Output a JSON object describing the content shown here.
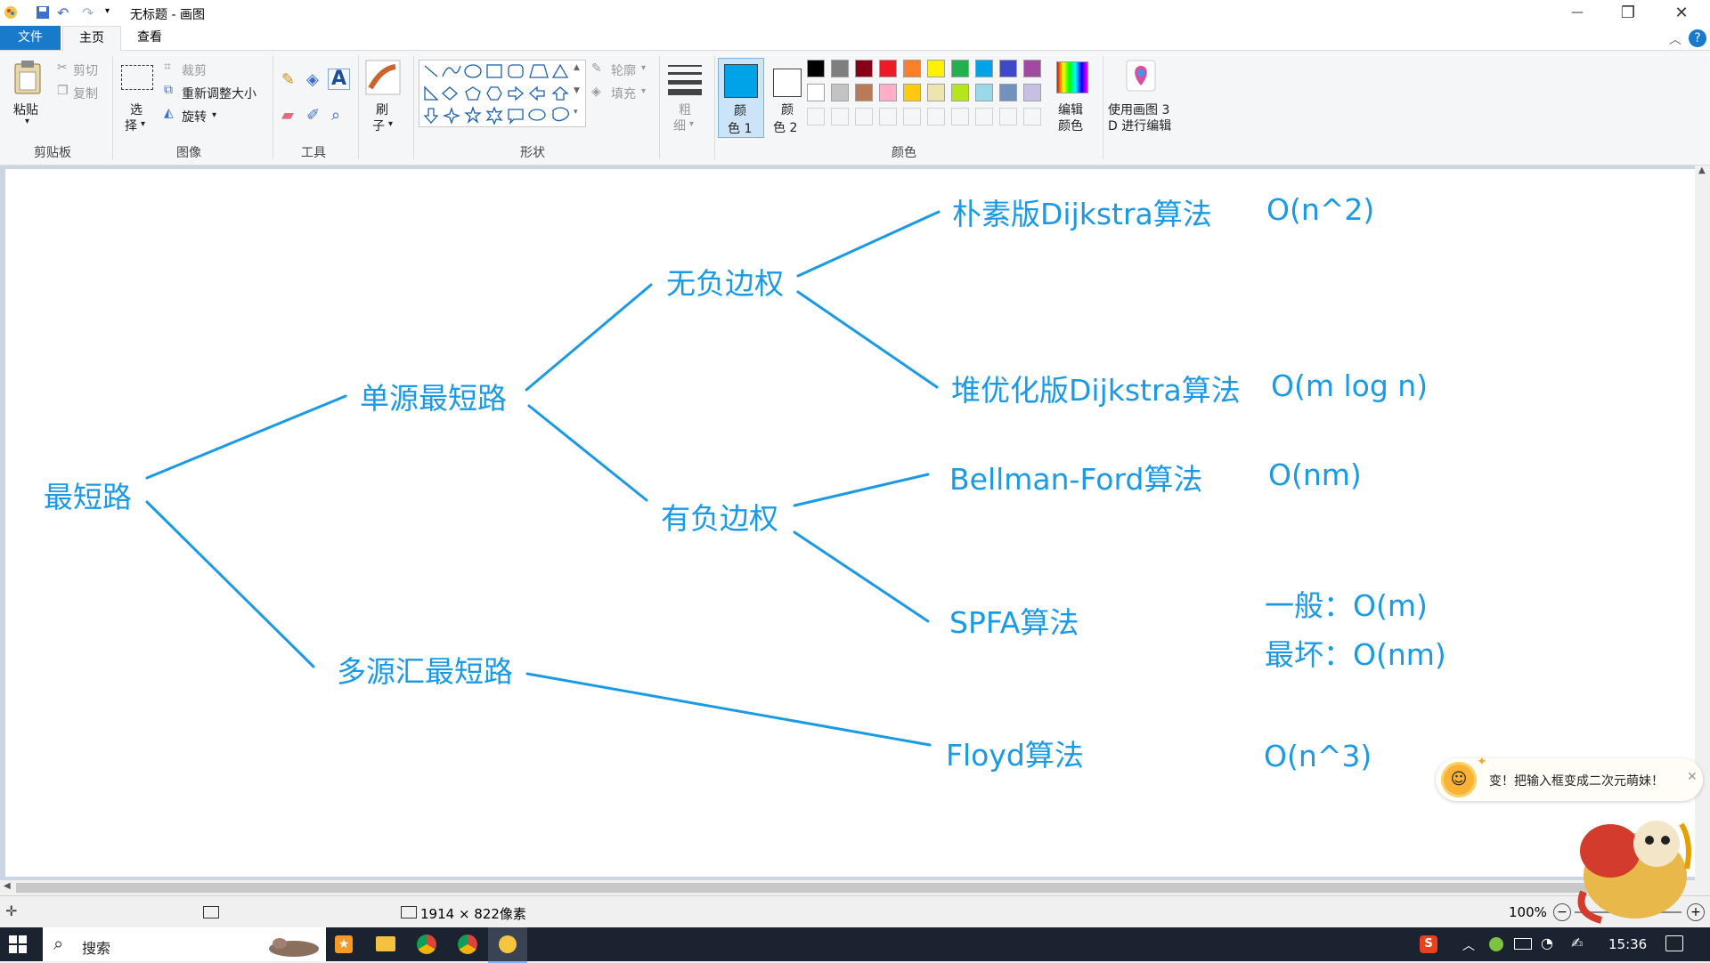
{
  "window": {
    "title": "无标题 - 画图",
    "controls": {
      "minimize": "—",
      "maximize": "❐",
      "close": "✕"
    }
  },
  "tabs": [
    {
      "label": "文件"
    },
    {
      "label": "主页"
    },
    {
      "label": "查看"
    }
  ],
  "ribbon": {
    "clipboard": {
      "paste": "粘贴",
      "cut": "剪切",
      "copy": "复制",
      "group": "剪贴板"
    },
    "image": {
      "select1": "选",
      "select2": "择",
      "crop": "裁剪",
      "resize": "重新调整大小",
      "rotate": "旋转",
      "group": "图像"
    },
    "tools": {
      "group": "工具"
    },
    "brush": {
      "label1": "刷",
      "label2": "子"
    },
    "shapes": {
      "outline": "轮廓",
      "fill": "填充",
      "group": "形状"
    },
    "size": {
      "label1": "粗",
      "label2": "细"
    },
    "color1": {
      "label1": "颜",
      "label2": "色 1"
    },
    "color2": {
      "label1": "颜",
      "label2": "色 2"
    },
    "edit_colors": {
      "label1": "编辑",
      "label2": "颜色"
    },
    "paint3d": {
      "label1": "使用画图 3",
      "label2": "D 进行编辑"
    },
    "colors_group": "颜色",
    "palette_row1": [
      "#000000",
      "#7f7f7f",
      "#880015",
      "#ed1c24",
      "#ff7f27",
      "#fff200",
      "#22b14c",
      "#00a2e8",
      "#3f48cc",
      "#a349a4"
    ],
    "palette_row2": [
      "#ffffff",
      "#c3c3c3",
      "#b97a57",
      "#ffaec9",
      "#ffc90e",
      "#efe4b0",
      "#b5e61d",
      "#99d9ea",
      "#7092be",
      "#c8bfe7"
    ],
    "color1_value": "#00a2e8",
    "color2_value": "#ffffff"
  },
  "diagram": {
    "root": "最短路",
    "single_source": "单源最短路",
    "multi_source": "多源汇最短路",
    "no_negative": "无负边权",
    "has_negative": "有负边权",
    "naive_dijkstra": "朴素版Dijkstra算法",
    "naive_dijkstra_complexity": "O(n^2)",
    "heap_dijkstra": "堆优化版Dijkstra算法",
    "heap_dijkstra_complexity": "O(m log n)",
    "bellman_ford": "Bellman-Ford算法",
    "bellman_ford_complexity": "O(nm)",
    "spfa": "SPFA算法",
    "spfa_general": "一般：O(m)",
    "spfa_worst": "最坏：O(nm)",
    "floyd": "Floyd算法",
    "floyd_complexity": "O(n^3)",
    "line_color": "#1a9ae6"
  },
  "status": {
    "dimensions": "1914 × 822像素",
    "zoom": "100%"
  },
  "notification": {
    "text": "变！把输入框变成二次元萌妹！"
  },
  "taskbar": {
    "search": "搜索",
    "time": "15:36"
  }
}
